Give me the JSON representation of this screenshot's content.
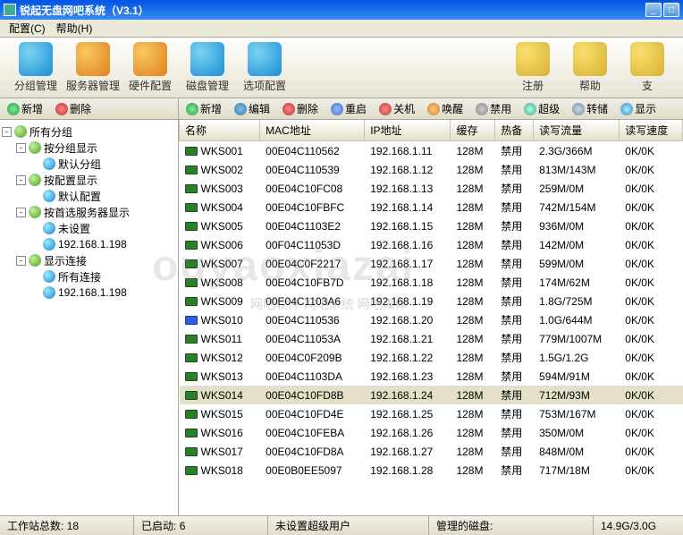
{
  "title": "锐起无盘网吧系统（V3.1）",
  "menu": [
    "配置(C)",
    "帮助(H)"
  ],
  "toolbar": [
    {
      "label": "分组管理",
      "icon": "blue"
    },
    {
      "label": "服务器管理",
      "icon": "orange"
    },
    {
      "label": "硬件配置",
      "icon": "orange"
    },
    {
      "label": "磁盘管理",
      "icon": "blue"
    },
    {
      "label": "选项配置",
      "icon": "blue"
    }
  ],
  "toolbar_right": [
    {
      "label": "注册",
      "icon": "yellow"
    },
    {
      "label": "帮助",
      "icon": "yellow"
    },
    {
      "label": "支",
      "icon": "yellow"
    }
  ],
  "left_tb": [
    {
      "label": "新增",
      "icon": "add"
    },
    {
      "label": "删除",
      "icon": "del"
    }
  ],
  "right_tb": [
    {
      "label": "新增",
      "icon": "add"
    },
    {
      "label": "编辑",
      "icon": "edit"
    },
    {
      "label": "删除",
      "icon": "del"
    },
    {
      "label": "重启",
      "icon": "reboot"
    },
    {
      "label": "关机",
      "icon": "shut"
    },
    {
      "label": "唤醒",
      "icon": "wake"
    },
    {
      "label": "禁用",
      "icon": "ban"
    },
    {
      "label": "超级",
      "icon": "super"
    },
    {
      "label": "转储",
      "icon": "dump"
    },
    {
      "label": "显示",
      "icon": "show"
    }
  ],
  "tree": [
    {
      "level": 0,
      "toggle": "-",
      "icon": "arrow",
      "label": "所有分组"
    },
    {
      "level": 1,
      "toggle": "-",
      "icon": "arrow",
      "label": "按分组显示"
    },
    {
      "level": 2,
      "toggle": "",
      "icon": "node",
      "label": "默认分组"
    },
    {
      "level": 1,
      "toggle": "-",
      "icon": "arrow",
      "label": "按配置显示"
    },
    {
      "level": 2,
      "toggle": "",
      "icon": "node",
      "label": "默认配置"
    },
    {
      "level": 1,
      "toggle": "-",
      "icon": "arrow",
      "label": "按首选服务器显示"
    },
    {
      "level": 2,
      "toggle": "",
      "icon": "node",
      "label": "未设置"
    },
    {
      "level": 2,
      "toggle": "",
      "icon": "node",
      "label": "192.168.1.198"
    },
    {
      "level": 1,
      "toggle": "-",
      "icon": "arrow",
      "label": "显示连接"
    },
    {
      "level": 2,
      "toggle": "",
      "icon": "node",
      "label": "所有连接"
    },
    {
      "level": 2,
      "toggle": "",
      "icon": "node",
      "label": "192.168.1.198"
    }
  ],
  "columns": [
    "名称",
    "MAC地址",
    "IP地址",
    "缓存",
    "热备",
    "读写流量",
    "读写速度"
  ],
  "rows": [
    {
      "name": "WKS001",
      "mac": "00E04C110562",
      "ip": "192.168.1.11",
      "cache": "128M",
      "hot": "禁用",
      "rw": "2.3G/366M",
      "spd": "0K/0K",
      "sel": false
    },
    {
      "name": "WKS002",
      "mac": "00E04C110539",
      "ip": "192.168.1.12",
      "cache": "128M",
      "hot": "禁用",
      "rw": "813M/143M",
      "spd": "0K/0K",
      "sel": false
    },
    {
      "name": "WKS003",
      "mac": "00E04C10FC08",
      "ip": "192.168.1.13",
      "cache": "128M",
      "hot": "禁用",
      "rw": "259M/0M",
      "spd": "0K/0K",
      "sel": false
    },
    {
      "name": "WKS004",
      "mac": "00E04C10FBFC",
      "ip": "192.168.1.14",
      "cache": "128M",
      "hot": "禁用",
      "rw": "742M/154M",
      "spd": "0K/0K",
      "sel": false
    },
    {
      "name": "WKS005",
      "mac": "00E04C1103E2",
      "ip": "192.168.1.15",
      "cache": "128M",
      "hot": "禁用",
      "rw": "936M/0M",
      "spd": "0K/0K",
      "sel": false
    },
    {
      "name": "WKS006",
      "mac": "00F04C11053D",
      "ip": "192.168.1.16",
      "cache": "128M",
      "hot": "禁用",
      "rw": "142M/0M",
      "spd": "0K/0K",
      "sel": false
    },
    {
      "name": "WKS007",
      "mac": "00E04C0F2217",
      "ip": "192.168.1.17",
      "cache": "128M",
      "hot": "禁用",
      "rw": "599M/0M",
      "spd": "0K/0K",
      "sel": false
    },
    {
      "name": "WKS008",
      "mac": "00E04C10FB7D",
      "ip": "192.168.1.18",
      "cache": "128M",
      "hot": "禁用",
      "rw": "174M/62M",
      "spd": "0K/0K",
      "sel": false
    },
    {
      "name": "WKS009",
      "mac": "00E04C1103A6",
      "ip": "192.168.1.19",
      "cache": "128M",
      "hot": "禁用",
      "rw": "1.8G/725M",
      "spd": "0K/0K",
      "sel": false
    },
    {
      "name": "WKS010",
      "mac": "00E04C110536",
      "ip": "192.168.1.20",
      "cache": "128M",
      "hot": "禁用",
      "rw": "1.0G/644M",
      "spd": "0K/0K",
      "sel": false,
      "blue": true
    },
    {
      "name": "WKS011",
      "mac": "00E04C11053A",
      "ip": "192.168.1.21",
      "cache": "128M",
      "hot": "禁用",
      "rw": "779M/1007M",
      "spd": "0K/0K",
      "sel": false
    },
    {
      "name": "WKS012",
      "mac": "00E04C0F209B",
      "ip": "192.168.1.22",
      "cache": "128M",
      "hot": "禁用",
      "rw": "1.5G/1.2G",
      "spd": "0K/0K",
      "sel": false
    },
    {
      "name": "WKS013",
      "mac": "00E04C1103DA",
      "ip": "192.168.1.23",
      "cache": "128M",
      "hot": "禁用",
      "rw": "594M/91M",
      "spd": "0K/0K",
      "sel": false
    },
    {
      "name": "WKS014",
      "mac": "00E04C10FD8B",
      "ip": "192.168.1.24",
      "cache": "128M",
      "hot": "禁用",
      "rw": "712M/93M",
      "spd": "0K/0K",
      "sel": true
    },
    {
      "name": "WKS015",
      "mac": "00E04C10FD4E",
      "ip": "192.168.1.25",
      "cache": "128M",
      "hot": "禁用",
      "rw": "753M/167M",
      "spd": "0K/0K",
      "sel": false
    },
    {
      "name": "WKS016",
      "mac": "00E04C10FEBA",
      "ip": "192.168.1.26",
      "cache": "128M",
      "hot": "禁用",
      "rw": "350M/0M",
      "spd": "0K/0K",
      "sel": false
    },
    {
      "name": "WKS017",
      "mac": "00E04C10FD8A",
      "ip": "192.168.1.27",
      "cache": "128M",
      "hot": "禁用",
      "rw": "848M/0M",
      "spd": "0K/0K",
      "sel": false
    },
    {
      "name": "WKS018",
      "mac": "00E0B0EE5097",
      "ip": "192.168.1.28",
      "cache": "128M",
      "hot": "禁用",
      "rw": "717M/18M",
      "spd": "0K/0K",
      "sel": false
    }
  ],
  "status": {
    "total_label": "工作站总数:",
    "total": "18",
    "started_label": "已启动:",
    "started": "6",
    "nouser": "未设置超级用户",
    "disks_label": "管理的磁盘:",
    "disk_size": "14.9G/3.0G"
  },
  "watermark": "ouyaoxiazai",
  "watermark_sub": "网吧软件 网吧系统 网吧媒体"
}
